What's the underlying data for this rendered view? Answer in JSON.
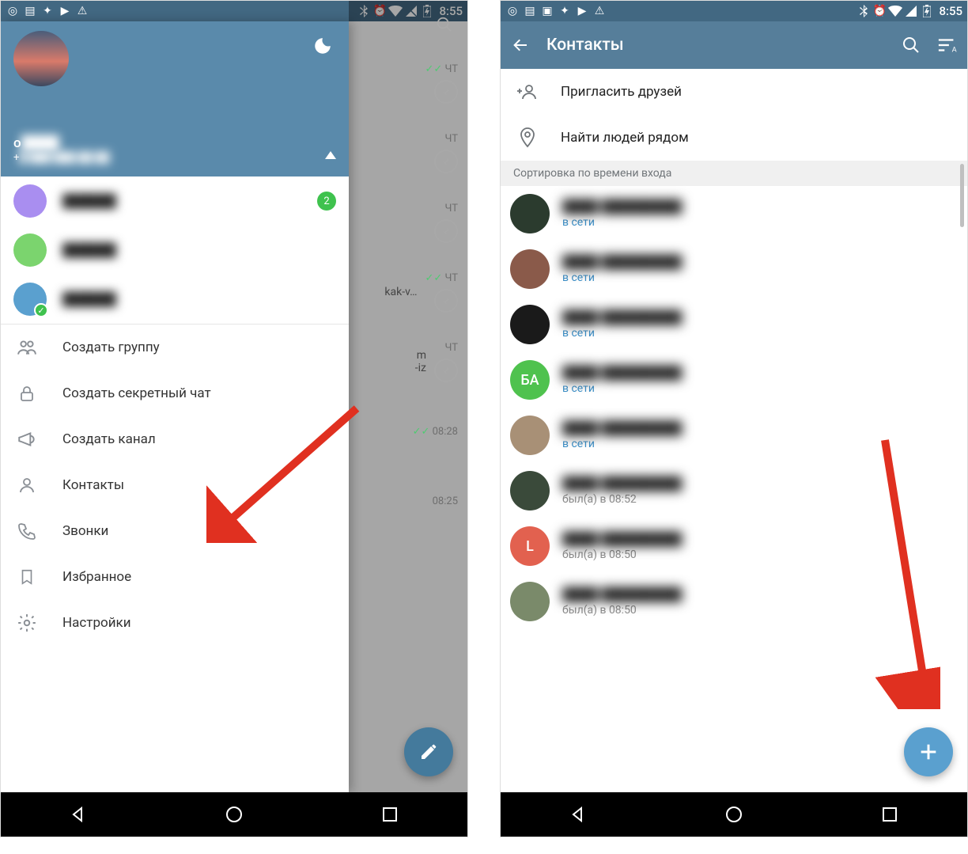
{
  "statusbar": {
    "time": "8:55"
  },
  "left": {
    "drawer": {
      "user": {
        "name": "o",
        "phone": "+"
      },
      "accounts": [
        {
          "color": "#a98ef0",
          "badge": "2"
        },
        {
          "color": "#7bd46e",
          "badge": null
        },
        {
          "color": "#5aa0cf",
          "badge": null,
          "check": true
        }
      ],
      "menu": [
        {
          "key": "create-group",
          "label": "Создать группу",
          "icon": "group"
        },
        {
          "key": "secret-chat",
          "label": "Создать секретный чат",
          "icon": "lock"
        },
        {
          "key": "create-channel",
          "label": "Создать канал",
          "icon": "megaphone"
        },
        {
          "key": "contacts",
          "label": "Контакты",
          "icon": "person"
        },
        {
          "key": "calls",
          "label": "Звонки",
          "icon": "phone"
        },
        {
          "key": "saved",
          "label": "Избранное",
          "icon": "bookmark"
        },
        {
          "key": "settings",
          "label": "Настройки",
          "icon": "gear"
        }
      ]
    },
    "background_chats": [
      {
        "time": "ЧТ",
        "checks": true,
        "pin": true,
        "text": ""
      },
      {
        "time": "ЧТ",
        "checks": false,
        "pin": true,
        "text": ""
      },
      {
        "time": "ЧТ",
        "checks": false,
        "pin": true,
        "text": ""
      },
      {
        "time": "ЧТ",
        "checks": true,
        "pin": true,
        "text": "kak-v…"
      },
      {
        "time": "ЧТ",
        "checks": false,
        "pin": true,
        "text": "m\n-iz"
      },
      {
        "time": "08:28",
        "checks": true,
        "pin": false,
        "text": ""
      },
      {
        "time": "08:25",
        "checks": false,
        "pin": false,
        "text": ""
      }
    ]
  },
  "right": {
    "appbar": {
      "title": "Контакты"
    },
    "actions": [
      {
        "key": "invite",
        "label": "Пригласить друзей",
        "icon": "invite"
      },
      {
        "key": "nearby",
        "label": "Найти людей рядом",
        "icon": "location"
      }
    ],
    "section_header": "Сортировка по времени входа",
    "contacts": [
      {
        "avatar_color": "#2b3b2e",
        "initials": "",
        "status": "в сети",
        "online": true
      },
      {
        "avatar_color": "#8a5a4a",
        "initials": "",
        "status": "в сети",
        "online": true
      },
      {
        "avatar_color": "#1a1a1a",
        "initials": "",
        "status": "в сети",
        "online": true
      },
      {
        "avatar_color": "#4fc24e",
        "initials": "БА",
        "status": "в сети",
        "online": true
      },
      {
        "avatar_color": "#a89076",
        "initials": "",
        "status": "в сети",
        "online": true
      },
      {
        "avatar_color": "#3a4a3a",
        "initials": "",
        "status": "был(а) в 08:52",
        "online": false
      },
      {
        "avatar_color": "#e2614f",
        "initials": "L",
        "status": "был(а) в 08:50",
        "online": false
      },
      {
        "avatar_color": "#7a8a6a",
        "initials": "",
        "status": "был(а) в 08:50",
        "online": false
      }
    ]
  }
}
